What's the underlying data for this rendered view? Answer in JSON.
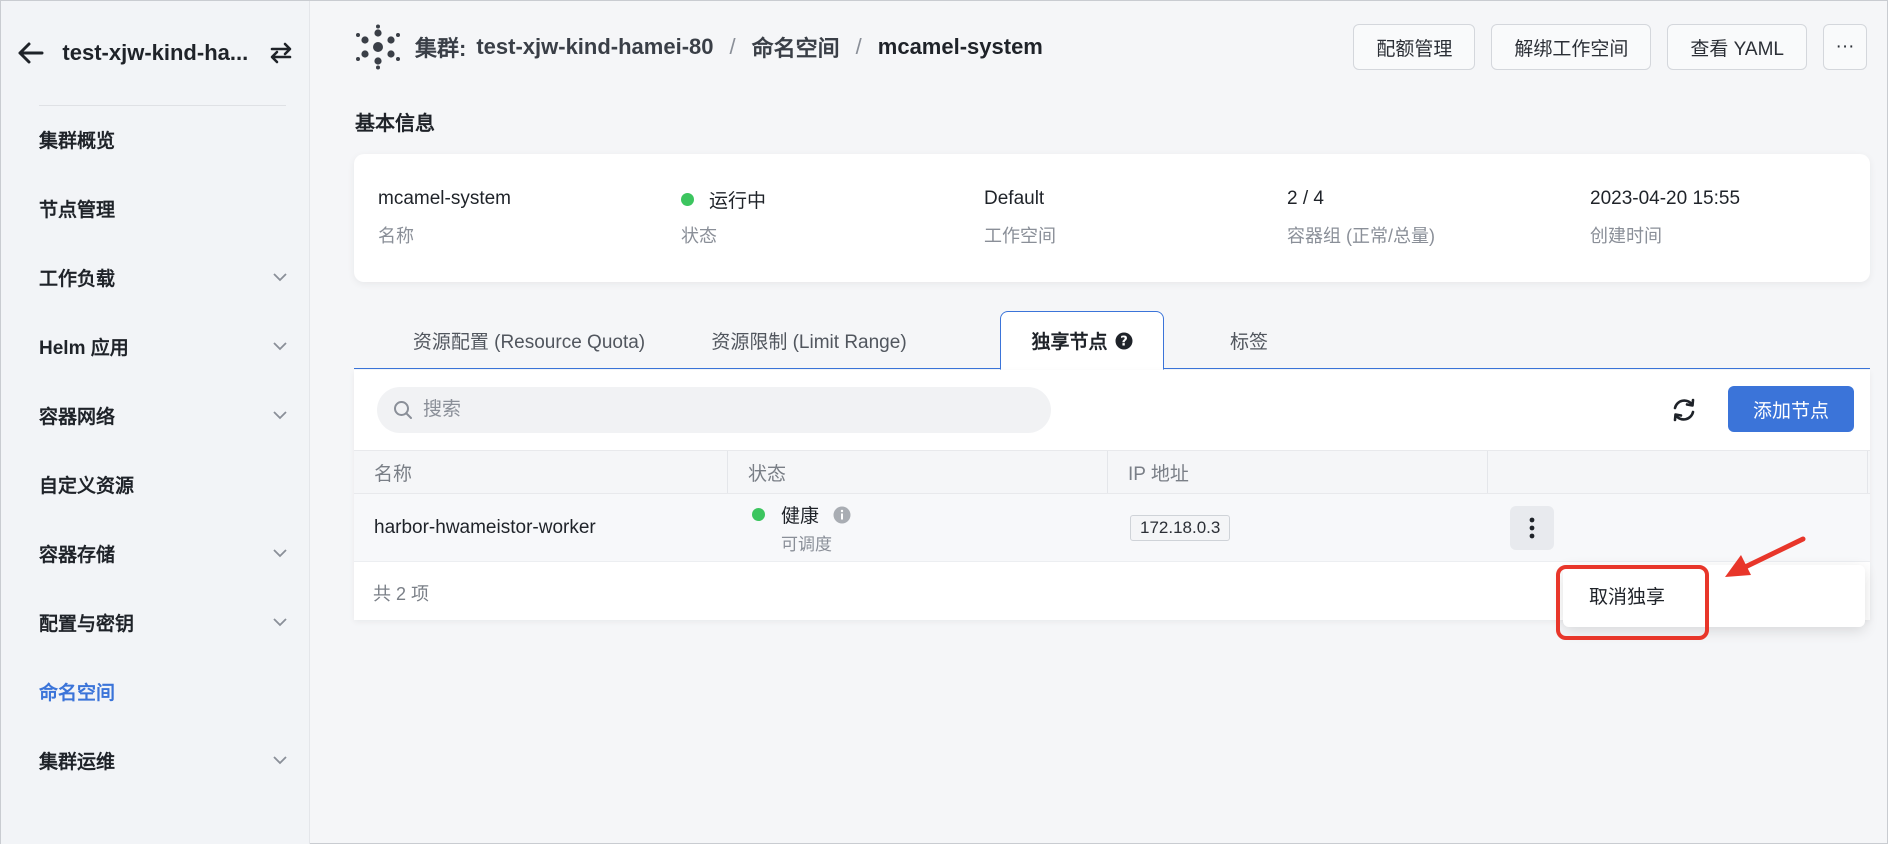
{
  "sidebar": {
    "cluster_name": "test-xjw-kind-ha...",
    "items": [
      {
        "label": "集群概览",
        "has_children": false
      },
      {
        "label": "节点管理",
        "has_children": false
      },
      {
        "label": "工作负载",
        "has_children": true
      },
      {
        "label": "Helm 应用",
        "has_children": true
      },
      {
        "label": "容器网络",
        "has_children": true
      },
      {
        "label": "自定义资源",
        "has_children": false
      },
      {
        "label": "容器存储",
        "has_children": true
      },
      {
        "label": "配置与密钥",
        "has_children": true
      },
      {
        "label": "命名空间",
        "has_children": false,
        "active": true
      },
      {
        "label": "集群运维",
        "has_children": true
      }
    ]
  },
  "header": {
    "cluster_label": "集群:",
    "cluster_name": "test-xjw-kind-hamei-80",
    "sep": "/",
    "namespace_label": "命名空间",
    "namespace_name": "mcamel-system",
    "actions": {
      "quota": "配额管理",
      "unbind": "解绑工作空间",
      "yaml": "查看 YAML",
      "more": "···"
    }
  },
  "basic_info": {
    "title": "基本信息",
    "fields": [
      {
        "value": "mcamel-system",
        "label": "名称"
      },
      {
        "value": "运行中",
        "label": "状态"
      },
      {
        "value": "Default",
        "label": "工作空间"
      },
      {
        "value": "2 / 4",
        "label": "容器组 (正常/总量)"
      },
      {
        "value": "2023-04-20 15:55",
        "label": "创建时间"
      }
    ]
  },
  "tabs": {
    "quota": "资源配置 (Resource Quota)",
    "limit": "资源限制 (Limit Range)",
    "exclusive": "独享节点",
    "labels": "标签"
  },
  "table": {
    "search_placeholder": "搜索",
    "add_button": "添加节点",
    "columns": {
      "name": "名称",
      "status": "状态",
      "ip": "IP 地址"
    },
    "rows": [
      {
        "name": "harbor-hwameistor-worker",
        "status": "健康",
        "sub_status": "可调度",
        "ip": "172.18.0.3"
      }
    ],
    "total": "共 2 项"
  },
  "dropdown": {
    "item": "取消独享"
  },
  "colors": {
    "accent": "#3b74d9",
    "success": "#3cc55f",
    "annotation": "#e8362a"
  }
}
